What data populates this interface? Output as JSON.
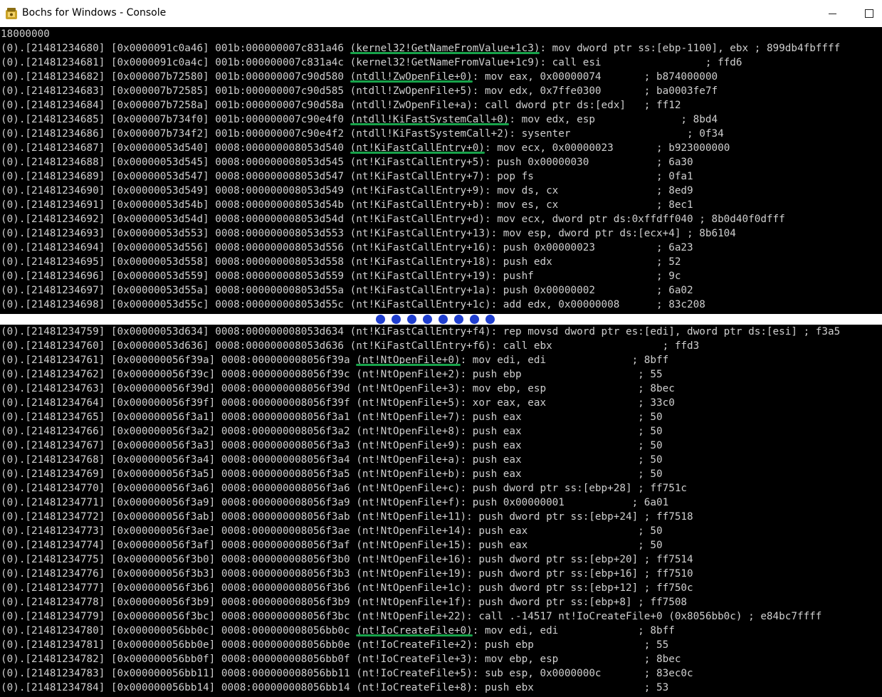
{
  "window": {
    "title": "Bochs for Windows - Console",
    "icon": "bochs-app-icon",
    "minimize_icon": "minimize-icon",
    "maximize_icon": "maximize-icon"
  },
  "colors": {
    "console_bg": "#000000",
    "console_text": "#cfcfcf",
    "highlight_underline": "#17a34a",
    "ellipsis_dots": "#1f3ecf"
  },
  "top_lines": [
    [
      "18000000"
    ],
    [
      "(0).[21481234680] [0x0000091c0a46] 001b:000000007c831a46 ",
      "(kernel32!GetNameFromValue+1c3)",
      ": mov dword ptr ss:[ebp-1100], ebx ; 899db4fbffff"
    ],
    [
      "(0).[21481234681] [0x0000091c0a4c] 001b:000000007c831a4c (kernel32!GetNameFromValue+1c9): call esi                 ; ffd6"
    ],
    [
      "(0).[21481234682] [0x000007b72580] 001b:000000007c90d580 ",
      "(ntdll!ZwOpenFile+0)",
      ": mov eax, 0x00000074       ; b874000000"
    ],
    [
      "(0).[21481234683] [0x000007b72585] 001b:000000007c90d585 (ntdll!ZwOpenFile+5): mov edx, 0x7ffe0300       ; ba0003fe7f"
    ],
    [
      "(0).[21481234684] [0x000007b7258a] 001b:000000007c90d58a (ntdll!ZwOpenFile+a): call dword ptr ds:[edx]   ; ff12"
    ],
    [
      "(0).[21481234685] [0x000007b734f0] 001b:000000007c90e4f0 ",
      "(ntdll!KiFastSystemCall+0)",
      ": mov edx, esp              ; 8bd4"
    ],
    [
      "(0).[21481234686] [0x000007b734f2] 001b:000000007c90e4f2 (ntdll!KiFastSystemCall+2): sysenter                   ; 0f34"
    ],
    [
      "(0).[21481234687] [0x00000053d540] 0008:000000008053d540 ",
      "(nt!KiFastCallEntry+0)",
      ": mov ecx, 0x00000023       ; b923000000"
    ],
    [
      "(0).[21481234688] [0x00000053d545] 0008:000000008053d545 (nt!KiFastCallEntry+5): push 0x00000030           ; 6a30"
    ],
    [
      "(0).[21481234689] [0x00000053d547] 0008:000000008053d547 (nt!KiFastCallEntry+7): pop fs                    ; 0fa1"
    ],
    [
      "(0).[21481234690] [0x00000053d549] 0008:000000008053d549 (nt!KiFastCallEntry+9): mov ds, cx                ; 8ed9"
    ],
    [
      "(0).[21481234691] [0x00000053d54b] 0008:000000008053d54b (nt!KiFastCallEntry+b): mov es, cx                ; 8ec1"
    ],
    [
      "(0).[21481234692] [0x00000053d54d] 0008:000000008053d54d (nt!KiFastCallEntry+d): mov ecx, dword ptr ds:0xffdff040 ; 8b0d40f0dfff"
    ],
    [
      "(0).[21481234693] [0x00000053d553] 0008:000000008053d553 (nt!KiFastCallEntry+13): mov esp, dword ptr ds:[ecx+4] ; 8b6104"
    ],
    [
      "(0).[21481234694] [0x00000053d556] 0008:000000008053d556 (nt!KiFastCallEntry+16): push 0x00000023          ; 6a23"
    ],
    [
      "(0).[21481234695] [0x00000053d558] 0008:000000008053d558 (nt!KiFastCallEntry+18): push edx                 ; 52"
    ],
    [
      "(0).[21481234696] [0x00000053d559] 0008:000000008053d559 (nt!KiFastCallEntry+19): pushf                    ; 9c"
    ],
    [
      "(0).[21481234697] [0x00000053d55a] 0008:000000008053d55a (nt!KiFastCallEntry+1a): push 0x00000002          ; 6a02"
    ],
    [
      "(0).[21481234698] [0x00000053d55c] 0008:000000008053d55c (nt!KiFastCallEntry+1c): add edx, 0x00000008      ; 83c208"
    ]
  ],
  "bottom_lines": [
    [
      "(0).[21481234759] [0x00000053d634] 0008:000000008053d634 (nt!KiFastCallEntry+f4): rep movsd dword ptr es:[edi], dword ptr ds:[esi] ; f3a5"
    ],
    [
      "(0).[21481234760] [0x00000053d636] 0008:000000008053d636 (nt!KiFastCallEntry+f6): call ebx                  ; ffd3"
    ],
    [
      "(0).[21481234761] [0x000000056f39a] 0008:000000008056f39a ",
      "(nt!NtOpenFile+0)",
      ": mov edi, edi              ; 8bff"
    ],
    [
      "(0).[21481234762] [0x000000056f39c] 0008:000000008056f39c (nt!NtOpenFile+2): push ebp                   ; 55"
    ],
    [
      "(0).[21481234763] [0x000000056f39d] 0008:000000008056f39d (nt!NtOpenFile+3): mov ebp, esp               ; 8bec"
    ],
    [
      "(0).[21481234764] [0x000000056f39f] 0008:000000008056f39f (nt!NtOpenFile+5): xor eax, eax               ; 33c0"
    ],
    [
      "(0).[21481234765] [0x000000056f3a1] 0008:000000008056f3a1 (nt!NtOpenFile+7): push eax                   ; 50"
    ],
    [
      "(0).[21481234766] [0x000000056f3a2] 0008:000000008056f3a2 (nt!NtOpenFile+8): push eax                   ; 50"
    ],
    [
      "(0).[21481234767] [0x000000056f3a3] 0008:000000008056f3a3 (nt!NtOpenFile+9): push eax                   ; 50"
    ],
    [
      "(0).[21481234768] [0x000000056f3a4] 0008:000000008056f3a4 (nt!NtOpenFile+a): push eax                   ; 50"
    ],
    [
      "(0).[21481234769] [0x000000056f3a5] 0008:000000008056f3a5 (nt!NtOpenFile+b): push eax                   ; 50"
    ],
    [
      "(0).[21481234770] [0x000000056f3a6] 0008:000000008056f3a6 (nt!NtOpenFile+c): push dword ptr ss:[ebp+28] ; ff751c"
    ],
    [
      "(0).[21481234771] [0x000000056f3a9] 0008:000000008056f3a9 (nt!NtOpenFile+f): push 0x00000001           ; 6a01"
    ],
    [
      "(0).[21481234772] [0x000000056f3ab] 0008:000000008056f3ab (nt!NtOpenFile+11): push dword ptr ss:[ebp+24] ; ff7518"
    ],
    [
      "(0).[21481234773] [0x000000056f3ae] 0008:000000008056f3ae (nt!NtOpenFile+14): push eax                  ; 50"
    ],
    [
      "(0).[21481234774] [0x000000056f3af] 0008:000000008056f3af (nt!NtOpenFile+15): push eax                  ; 50"
    ],
    [
      "(0).[21481234775] [0x000000056f3b0] 0008:000000008056f3b0 (nt!NtOpenFile+16): push dword ptr ss:[ebp+20] ; ff7514"
    ],
    [
      "(0).[21481234776] [0x000000056f3b3] 0008:000000008056f3b3 (nt!NtOpenFile+19): push dword ptr ss:[ebp+16] ; ff7510"
    ],
    [
      "(0).[21481234777] [0x000000056f3b6] 0008:000000008056f3b6 (nt!NtOpenFile+1c): push dword ptr ss:[ebp+12] ; ff750c"
    ],
    [
      "(0).[21481234778] [0x000000056f3b9] 0008:000000008056f3b9 (nt!NtOpenFile+1f): push dword ptr ss:[ebp+8] ; ff7508"
    ],
    [
      "(0).[21481234779] [0x000000056f3bc] 0008:000000008056f3bc (nt!NtOpenFile+22): call .-14517 nt!IoCreateFile+0 (0x8056bb0c) ; e84bc7ffff"
    ],
    [
      "(0).[21481234780] [0x000000056bb0c] 0008:000000008056bb0c ",
      "(nt!IoCreateFile+0)",
      ": mov edi, edi             ; 8bff"
    ],
    [
      "(0).[21481234781] [0x000000056bb0e] 0008:000000008056bb0e (nt!IoCreateFile+2): push ebp                  ; 55"
    ],
    [
      "(0).[21481234782] [0x000000056bb0f] 0008:000000008056bb0f (nt!IoCreateFile+3): mov ebp, esp              ; 8bec"
    ],
    [
      "(0).[21481234783] [0x000000056bb11] 0008:000000008056bb11 (nt!IoCreateFile+5): sub esp, 0x0000000c       ; 83ec0c"
    ],
    [
      "(0).[21481234784] [0x000000056bb14] 0008:000000008056bb14 (nt!IoCreateFile+8): push ebx                  ; 53"
    ]
  ],
  "ellipsis": {
    "dot_count": 8
  }
}
